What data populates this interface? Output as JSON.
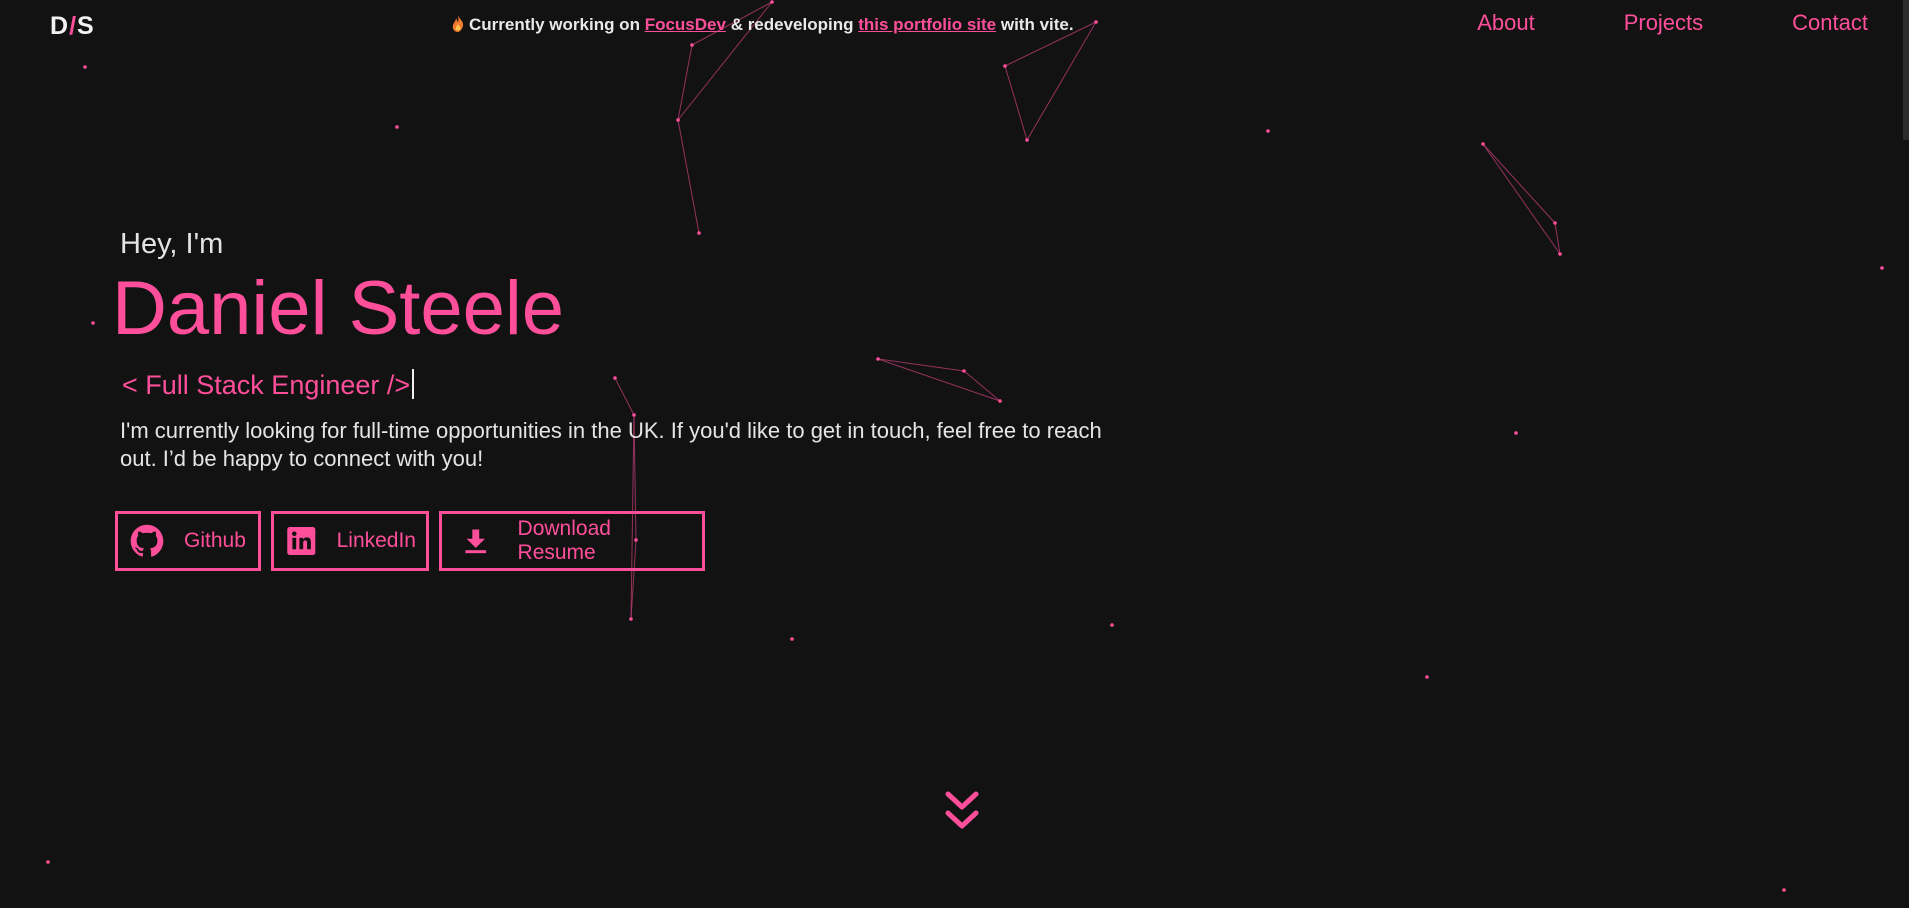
{
  "logo": {
    "d": "D",
    "slash": "/",
    "s": "S"
  },
  "banner": {
    "prefix": "Currently working on",
    "link1": "FocusDev",
    "middle": "& redeveloping",
    "link2": "this portfolio site",
    "suffix": "with vite."
  },
  "nav": {
    "about": "About",
    "projects": "Projects",
    "contact": "Contact"
  },
  "hero": {
    "greeting": "Hey, I'm",
    "name": "Daniel Steele",
    "role": "< Full Stack Engineer />",
    "bio": "I'm currently looking for full-time opportunities in the UK. If you'd like to get in touch, feel free to reach out. I’d be happy to connect with you!"
  },
  "buttons": {
    "github": "Github",
    "linkedin": "LinkedIn",
    "resume": "Download Resume"
  },
  "colors": {
    "accent": "#ff4f9b",
    "background": "#121212",
    "text": "#e4e4e4"
  },
  "icons": {
    "banner": "flame-icon",
    "github": "github-icon",
    "linkedin": "linkedin-icon",
    "resume": "download-icon",
    "scroll": "double-chevron-down-icon"
  }
}
